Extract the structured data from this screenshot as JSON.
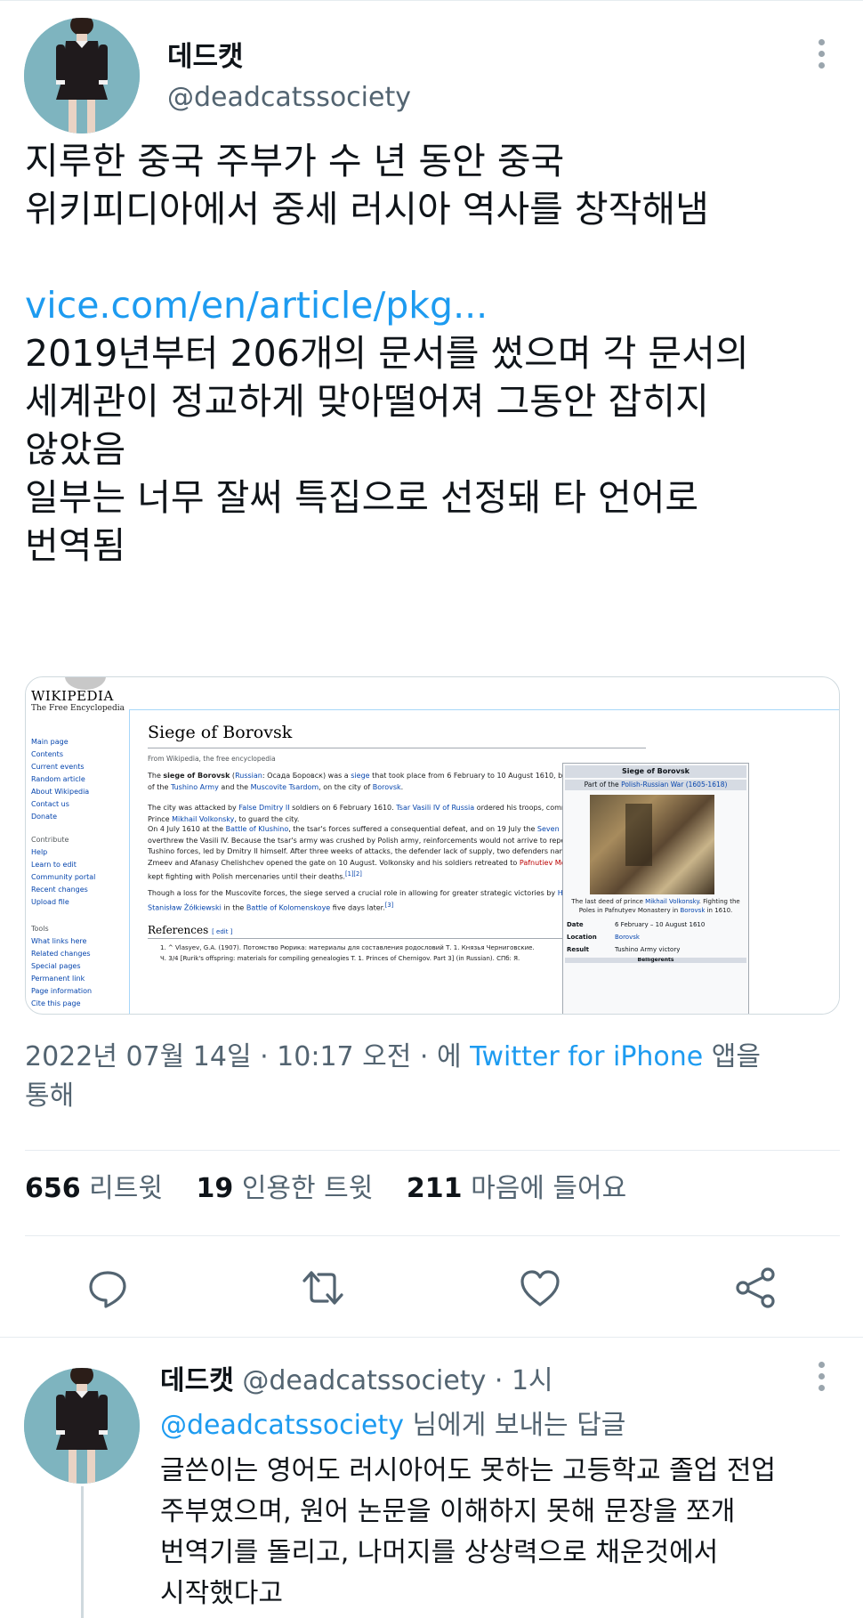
{
  "tweet": {
    "author": {
      "display_name": "데드캣",
      "handle": "@deadcatssociety"
    },
    "text_lines_1": [
      "지루한 중국 주부가 수 년 동안 중국",
      "위키피디아에서 중세 러시아 역사를 창작해냄"
    ],
    "link": "vice.com/en/article/pkg...",
    "text_lines_2": [
      "2019년부터 206개의 문서를 썼으며 각 문서의",
      "세계관이 정교하게 맞아떨어져 그동안 잡히지",
      "않았음",
      "일부는 너무 잘써 특집으로 선정돼 타 언어로",
      "번역됨"
    ],
    "timestamp_prefix": "2022년 07월 14일 · 10:17 오전 · 에 ",
    "source": "Twitter for iPhone",
    "timestamp_suffix": " 앱을",
    "timestamp_line2": "통해",
    "stats": [
      {
        "count": "656",
        "label": "리트윗"
      },
      {
        "count": "19",
        "label": "인용한 트윗"
      },
      {
        "count": "211",
        "label": "마음에 들어요"
      }
    ],
    "actions": [
      "reply-icon",
      "retweet-icon",
      "like-icon",
      "share-icon"
    ],
    "colors": {
      "link": "#1d9bf0",
      "secondary": "#536471",
      "avatar_bg": "#7eb4bf"
    }
  },
  "media": {
    "wiki_logo": "WIKIPEDIA",
    "wiki_tagline": "The Free Encyclopedia",
    "sidebar_nav": [
      "Main page",
      "Contents",
      "Current events",
      "Random article",
      "About Wikipedia",
      "Contact us",
      "Donate"
    ],
    "sidebar_contribute_heading": "Contribute",
    "sidebar_contribute": [
      "Help",
      "Learn to edit",
      "Community portal",
      "Recent changes",
      "Upload file"
    ],
    "sidebar_tools_heading": "Tools",
    "sidebar_tools": [
      "What links here",
      "Related changes",
      "Special pages",
      "Permanent link",
      "Page information",
      "Cite this page"
    ],
    "title": "Siege of Borovsk",
    "from": "From Wikipedia, the free encyclopedia",
    "references_title": "References",
    "references_edit": "[ edit ]",
    "ref1": "1. ^ Vlasyev, G.A. (1907). Потомство Рюрика: материалы для составления родословий Т. 1. Князья Черниговские.",
    "ref2": "Ч. 3/4 [Rurik's offspring: materials for compiling genealogies T. 1. Princes of Chernigov. Part 3] (in Russian). СПб: Я.",
    "infobox": {
      "title": "Siege of Borovsk",
      "subtitle_prefix": "Part of the ",
      "subtitle_link": "Polish-Russian War (1605-1618)",
      "caption_a": "The last deed of prince ",
      "caption_link1": "Mikhail Volkonsky",
      "caption_b": ". Fighting the Poles in Pafnutyev Monastery in ",
      "caption_link2": "Borovsk",
      "caption_c": " in 1610.",
      "rows": [
        {
          "key": "Date",
          "value": "6 February – 10 August 1610"
        },
        {
          "key": "Location",
          "value": "Borovsk"
        },
        {
          "key": "Result",
          "value": "Tushino Army victory"
        }
      ],
      "belligerents": "Belligerents"
    }
  },
  "reply": {
    "display_name": "데드캣",
    "handle": "@deadcatssociety",
    "time": " · 1시",
    "reply_to_handle": "@deadcatssociety",
    "reply_to_suffix": " 님에게 보내는 답글",
    "text_lines": [
      "글쓴이는 영어도 러시아어도 못하는 고등학교 졸업 전업",
      "주부였으며, 원어 논문을 이해하지 못해 문장을 쪼개",
      "번역기를 돌리고, 나머지를 상상력으로 채운것에서",
      "시작했다고"
    ]
  }
}
